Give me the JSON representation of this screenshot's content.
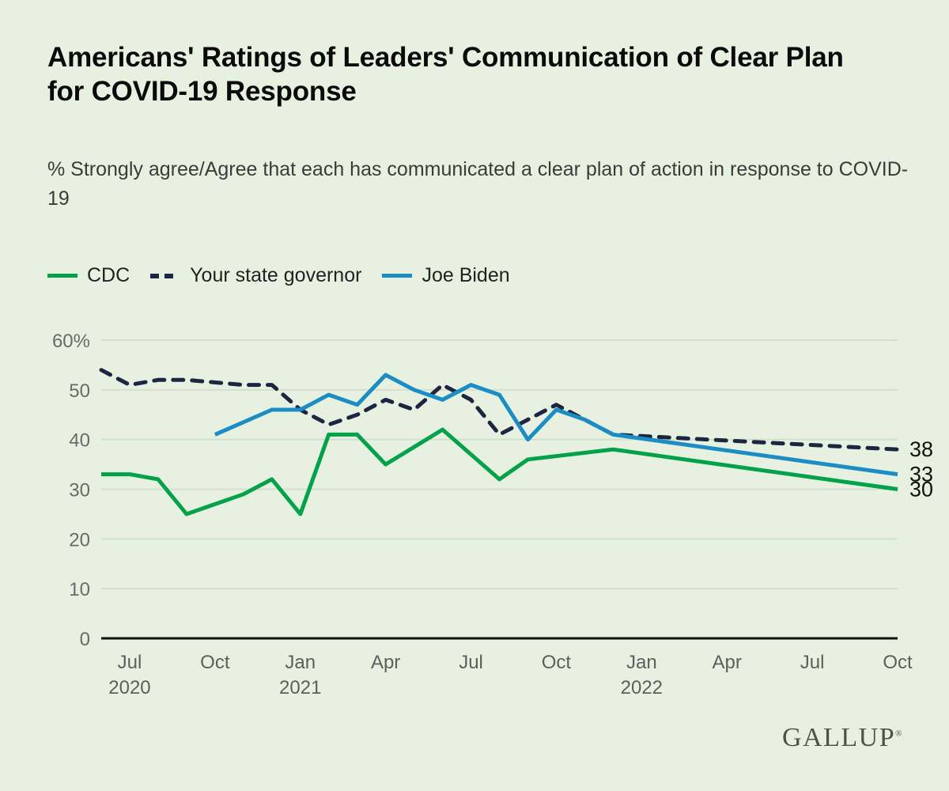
{
  "title": "Americans' Ratings of Leaders' Communication of Clear Plan for COVID-19 Response",
  "subtitle": "% Strongly agree/Agree that each has communicated a clear plan of action in response to COVID-19",
  "brand": "GALLUP",
  "brand_mark": "®",
  "legend": [
    {
      "label": "CDC",
      "style": "solid",
      "color": "#00a14b"
    },
    {
      "label": "Your state governor",
      "style": "dashed",
      "color": "#1c2541"
    },
    {
      "label": "Joe Biden",
      "style": "solid",
      "color": "#1c8dc4"
    }
  ],
  "end_labels": {
    "governor": "38",
    "biden": "33",
    "cdc": "30"
  },
  "chart_data": {
    "type": "line",
    "title": "Americans' Ratings of Leaders' Communication of Clear Plan for COVID-19 Response",
    "subtitle": "% Strongly agree/Agree that each has communicated a clear plan of action in response to COVID-19",
    "xlabel": "",
    "ylabel": "%",
    "ylim": [
      0,
      60
    ],
    "yticks": [
      0,
      10,
      20,
      30,
      40,
      50,
      60
    ],
    "ytick_labels": [
      "0",
      "10",
      "20",
      "30",
      "40",
      "50",
      "60%"
    ],
    "grid": true,
    "legend_position": "top-left",
    "x_axis_ticks": [
      {
        "label": "Jul",
        "sublabel": "2020",
        "month": "2020-07"
      },
      {
        "label": "Oct",
        "sublabel": "",
        "month": "2020-10"
      },
      {
        "label": "Jan",
        "sublabel": "2021",
        "month": "2021-01"
      },
      {
        "label": "Apr",
        "sublabel": "",
        "month": "2021-04"
      },
      {
        "label": "Jul",
        "sublabel": "",
        "month": "2021-07"
      },
      {
        "label": "Oct",
        "sublabel": "",
        "month": "2021-10"
      },
      {
        "label": "Jan",
        "sublabel": "2022",
        "month": "2022-01"
      },
      {
        "label": "Apr",
        "sublabel": "",
        "month": "2022-04"
      },
      {
        "label": "Jul",
        "sublabel": "",
        "month": "2022-07"
      },
      {
        "label": "Oct",
        "sublabel": "",
        "month": "2022-10"
      }
    ],
    "series": [
      {
        "name": "CDC",
        "color": "#00a14b",
        "style": "solid",
        "points": [
          {
            "x": "2020-06",
            "y": 33
          },
          {
            "x": "2020-07",
            "y": 33
          },
          {
            "x": "2020-08",
            "y": 32
          },
          {
            "x": "2020-09",
            "y": 25
          },
          {
            "x": "2020-11",
            "y": 29
          },
          {
            "x": "2020-12",
            "y": 32
          },
          {
            "x": "2021-01",
            "y": 25
          },
          {
            "x": "2021-02",
            "y": 41
          },
          {
            "x": "2021-03",
            "y": 41
          },
          {
            "x": "2021-04",
            "y": 35
          },
          {
            "x": "2021-06",
            "y": 42
          },
          {
            "x": "2021-08",
            "y": 32
          },
          {
            "x": "2021-09",
            "y": 36
          },
          {
            "x": "2021-12",
            "y": 38
          },
          {
            "x": "2022-10",
            "y": 30
          }
        ]
      },
      {
        "name": "Your state governor",
        "color": "#1c2541",
        "style": "dashed",
        "points": [
          {
            "x": "2020-06",
            "y": 54
          },
          {
            "x": "2020-07",
            "y": 51
          },
          {
            "x": "2020-08",
            "y": 52
          },
          {
            "x": "2020-09",
            "y": 52
          },
          {
            "x": "2020-11",
            "y": 51
          },
          {
            "x": "2020-12",
            "y": 51
          },
          {
            "x": "2021-01",
            "y": 46
          },
          {
            "x": "2021-02",
            "y": 43
          },
          {
            "x": "2021-03",
            "y": 45
          },
          {
            "x": "2021-04",
            "y": 48
          },
          {
            "x": "2021-05",
            "y": 46
          },
          {
            "x": "2021-06",
            "y": 51
          },
          {
            "x": "2021-07",
            "y": 48
          },
          {
            "x": "2021-08",
            "y": 41
          },
          {
            "x": "2021-09",
            "y": 44
          },
          {
            "x": "2021-10",
            "y": 47
          },
          {
            "x": "2021-12",
            "y": 41
          },
          {
            "x": "2022-10",
            "y": 38
          }
        ]
      },
      {
        "name": "Joe Biden",
        "color": "#1c8dc4",
        "style": "solid",
        "points": [
          {
            "x": "2020-10",
            "y": 41
          },
          {
            "x": "2020-12",
            "y": 46
          },
          {
            "x": "2021-01",
            "y": 46
          },
          {
            "x": "2021-02",
            "y": 49
          },
          {
            "x": "2021-03",
            "y": 47
          },
          {
            "x": "2021-04",
            "y": 53
          },
          {
            "x": "2021-05",
            "y": 50
          },
          {
            "x": "2021-06",
            "y": 48
          },
          {
            "x": "2021-07",
            "y": 51
          },
          {
            "x": "2021-08",
            "y": 49
          },
          {
            "x": "2021-09",
            "y": 40
          },
          {
            "x": "2021-10",
            "y": 46
          },
          {
            "x": "2021-11",
            "y": 44
          },
          {
            "x": "2021-12",
            "y": 41
          },
          {
            "x": "2022-10",
            "y": 33
          }
        ]
      }
    ]
  }
}
